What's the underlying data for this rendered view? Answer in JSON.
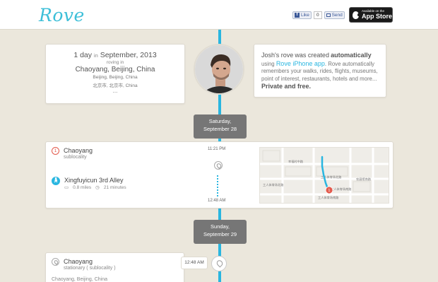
{
  "header": {
    "logo": "Rove",
    "fb_like": "Like",
    "fb_count": "0",
    "fb_send": "Send",
    "appstore_small": "Available on the",
    "appstore_big": "App Store"
  },
  "summary": {
    "days": "1 day",
    "in": "in",
    "month": "September, 2013",
    "roving": "roving in",
    "place": "Chaoyang, Beijing, China",
    "sub1": "Beijing, Beijing, China",
    "sub2": "北京市, 北京市, China",
    "dots": "..."
  },
  "about": {
    "name": "Josh's rove",
    "was_created": "was created",
    "automatically": "automatically",
    "using": "using",
    "app_link": "Rove iPhone app",
    "desc": ". Rove automatically remembers your walks, rides, flights, museums, point of interest, restaurants, hotels and more...",
    "tagline": "Private and free."
  },
  "dates": [
    {
      "weekday": "Saturday,",
      "date": "September 28"
    },
    {
      "weekday": "Sunday,",
      "date": "September 29"
    }
  ],
  "day1": {
    "place1": {
      "title": "Chaoyang",
      "sub": "sublocality",
      "num": "1"
    },
    "place2": {
      "title": "Xingfuyicun 3rd Alley",
      "distance": "0.8 miles",
      "duration": "21 minutes"
    },
    "time_start": "11:21 PM",
    "time_end": "12:48 AM",
    "map_labels": [
      "幸福村中路",
      "工人体育场北路",
      "工人体育场北路",
      "工人体育场南路",
      "工人体育场南路",
      "农展馆南路"
    ],
    "map_pin_num": "1"
  },
  "day2": {
    "place": {
      "title": "Chaoyang",
      "sub": "stationary ( sublocality )",
      "addr": "Chaoyang, Beijing, China"
    },
    "time": "12:48 AM"
  },
  "colors": {
    "accent": "#29b6e0",
    "badge": "#767676",
    "marker": "#e35a4c"
  }
}
